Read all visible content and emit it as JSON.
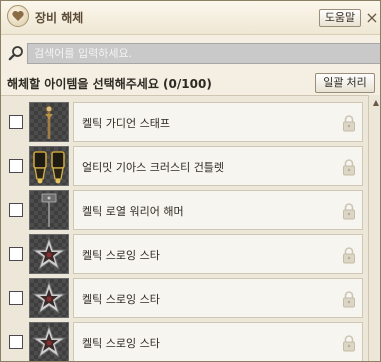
{
  "window": {
    "title": "장비 해체",
    "help_label": "도움말",
    "close_glyph": "×"
  },
  "search": {
    "placeholder": "검색어를 입력하세요.",
    "value": ""
  },
  "list_header": {
    "instruction": "해체할 아이템을 선택해주세요 (0/100)",
    "bulk_label": "일괄 처리"
  },
  "scrollbar": {
    "up_glyph": "▲"
  },
  "items": [
    {
      "name": "켈틱 가디언 스태프",
      "icon": "staff-icon",
      "checked": false,
      "locked": false
    },
    {
      "name": "얼티밋 기아스 크러스티 건틀렛",
      "icon": "gauntlet-icon",
      "checked": false,
      "locked": false
    },
    {
      "name": "켈틱 로열 워리어 해머",
      "icon": "hammer-icon",
      "checked": false,
      "locked": false
    },
    {
      "name": "켈틱 스로잉 스타",
      "icon": "throwing-star-icon",
      "checked": false,
      "locked": false
    },
    {
      "name": "켈틱 스로잉 스타",
      "icon": "throwing-star-icon",
      "checked": false,
      "locked": false
    },
    {
      "name": "켈틱 스로잉 스타",
      "icon": "throwing-star-icon",
      "checked": false,
      "locked": false
    }
  ]
}
